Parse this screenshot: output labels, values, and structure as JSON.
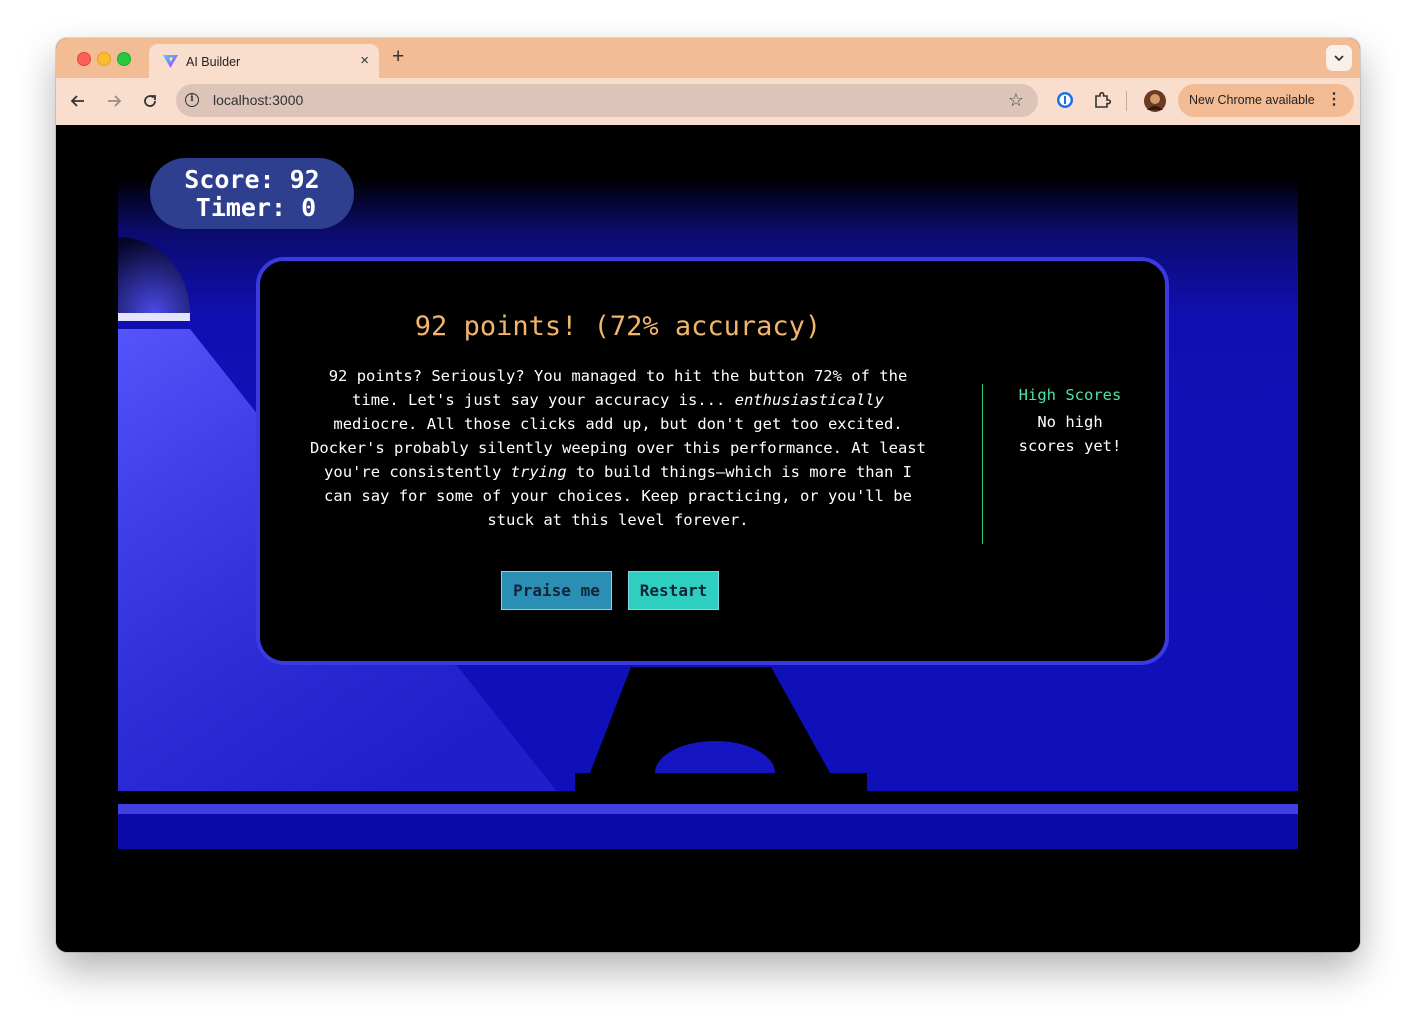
{
  "browser": {
    "tab_title": "AI Builder",
    "tab_close": "×",
    "new_tab": "+",
    "url": "localhost:3000",
    "update_label": "New Chrome available",
    "menu_glyph": "⋮"
  },
  "game": {
    "score_line": "Score: 92",
    "timer_line": "Timer: 0",
    "result_title": "92 points! (72% accuracy)",
    "feedback": {
      "part1": "92 points? Seriously? You managed to hit the button 72% of the time. Let's just say your accuracy is... ",
      "emph1": "enthusiastically",
      "part2": " mediocre. All those clicks add up, but don't get too excited. Docker's probably silently weeping over this performance. At least you're consistently ",
      "emph2": "trying",
      "part3": " to build things—which is more than I can say for some of your choices. Keep practicing, or you'll be stuck at this level forever."
    },
    "buttons": {
      "praise": "Praise me",
      "restart": "Restart"
    },
    "high_scores": {
      "title": "High Scores",
      "empty": "No high scores yet!"
    }
  },
  "colors": {
    "tab_strip": "#f2bc95",
    "toolbar": "#f9ddcd",
    "stage_blue": "#1010bb",
    "modal_border": "#3a3ae0",
    "title_orange": "#f2b56b",
    "hs_green": "#4fe3a6",
    "praise_button": "#2b8fb4",
    "restart_button": "#2ecfc0"
  }
}
